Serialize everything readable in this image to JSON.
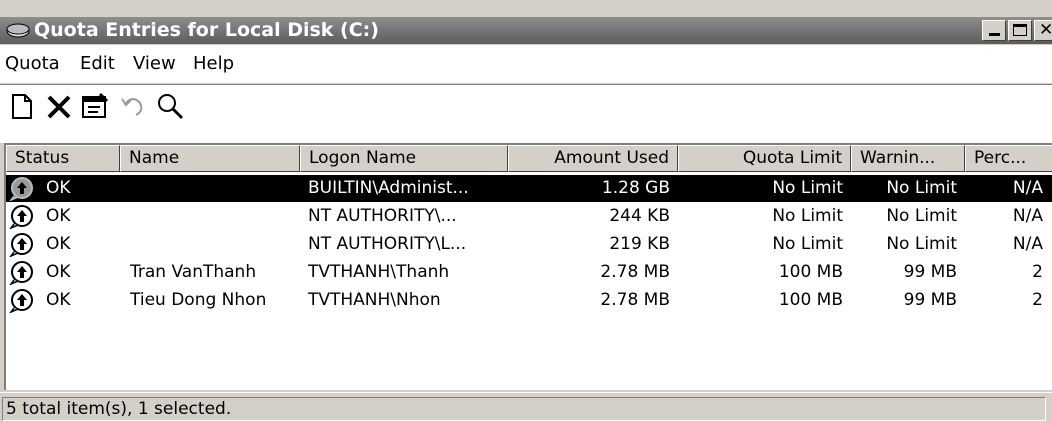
{
  "window": {
    "title": "Quota Entries for Local Disk (C:)"
  },
  "menu": [
    "Quota",
    "Edit",
    "View",
    "Help"
  ],
  "toolbar": [
    "new-quota-entry-icon",
    "delete-icon",
    "properties-icon",
    "undo-icon",
    "find-icon"
  ],
  "columns": [
    "Status",
    "Name",
    "Logon Name",
    "Amount Used",
    "Quota Limit",
    "Warnin...",
    "Perc..."
  ],
  "rows": [
    {
      "status": "OK",
      "name": "",
      "logon": "BUILTIN\\Administ...",
      "used": "1.28 GB",
      "limit": "No Limit",
      "warning": "No Limit",
      "percent": "N/A",
      "selected": true
    },
    {
      "status": "OK",
      "name": "",
      "logon": "NT AUTHORITY\\...",
      "used": "244 KB",
      "limit": "No Limit",
      "warning": "No Limit",
      "percent": "N/A",
      "selected": false
    },
    {
      "status": "OK",
      "name": "",
      "logon": "NT AUTHORITY\\L...",
      "used": "219 KB",
      "limit": "No Limit",
      "warning": "No Limit",
      "percent": "N/A",
      "selected": false
    },
    {
      "status": "OK",
      "name": "Tran VanThanh",
      "logon": "TVTHANH\\Thanh",
      "used": "2.78 MB",
      "limit": "100 MB",
      "warning": "99 MB",
      "percent": "2",
      "selected": false
    },
    {
      "status": "OK",
      "name": "Tieu Dong Nhon",
      "logon": "TVTHANH\\Nhon",
      "used": "2.78 MB",
      "limit": "100 MB",
      "warning": "99 MB",
      "percent": "2",
      "selected": false
    }
  ],
  "status_bar": "5 total item(s), 1 selected."
}
